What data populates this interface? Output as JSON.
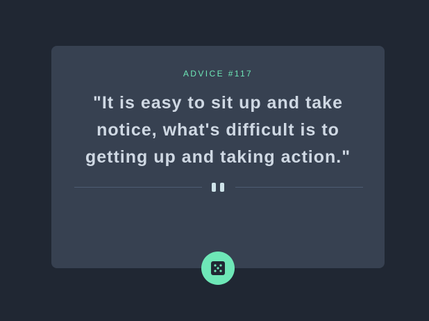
{
  "advice": {
    "id_label": "ADVICE #117",
    "quote": "\"It is easy to sit up and take notice, what's difficult is to getting up and taking action.\""
  },
  "icons": {
    "divider": "pause-icon",
    "button": "dice-icon"
  },
  "colors": {
    "background": "#202733",
    "card": "#374151",
    "accent": "#6ee7b7",
    "quote_text": "#cfd8e3"
  }
}
